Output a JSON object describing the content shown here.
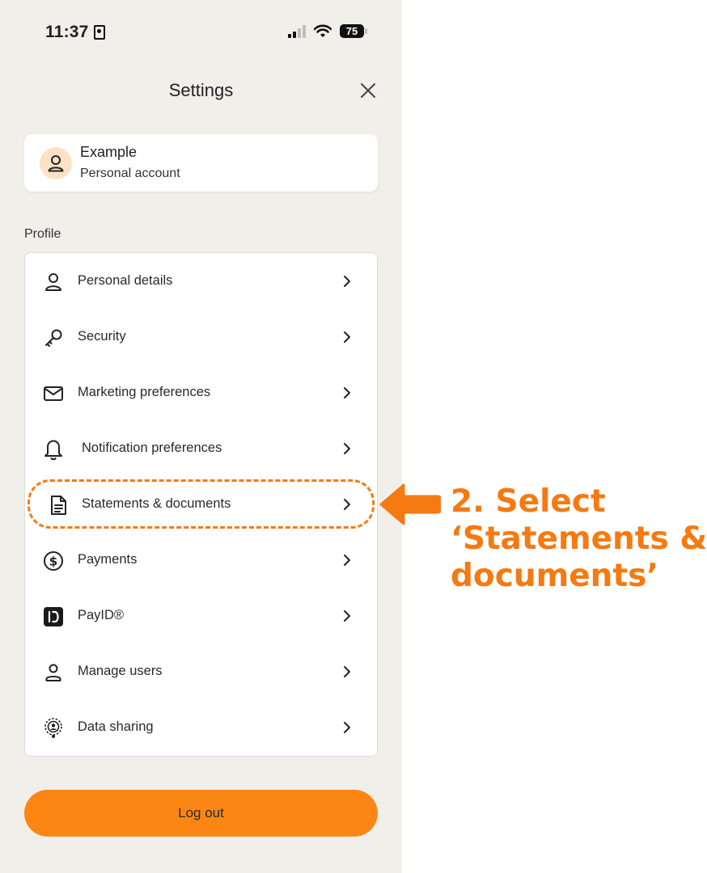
{
  "status_bar": {
    "time": "11:37",
    "battery": "75"
  },
  "header": {
    "title": "Settings"
  },
  "account": {
    "name": "Example",
    "type": "Personal account"
  },
  "profile_section": {
    "label": "Profile",
    "items": [
      {
        "label": "Personal details",
        "icon": "person-icon"
      },
      {
        "label": "Security",
        "icon": "key-icon"
      },
      {
        "label": "Marketing preferences",
        "icon": "mail-icon"
      },
      {
        "label": "Notification preferences",
        "icon": "bell-icon"
      },
      {
        "label": "Statements & documents",
        "icon": "document-icon"
      },
      {
        "label": "Payments",
        "icon": "dollar-circle-icon"
      },
      {
        "label": "PayID®",
        "icon": "payid-icon"
      },
      {
        "label": "Manage users",
        "icon": "user-icon"
      },
      {
        "label": "Data sharing",
        "icon": "data-sharing-icon"
      }
    ]
  },
  "logout": {
    "label": "Log out"
  },
  "annotation": {
    "line1": "2. Select",
    "line2": "‘Statements &",
    "line3": "documents’"
  },
  "colors": {
    "accent": "#f57a12",
    "button": "#fc8614",
    "background": "#f0efea",
    "avatar_bg": "#fde3c4"
  }
}
